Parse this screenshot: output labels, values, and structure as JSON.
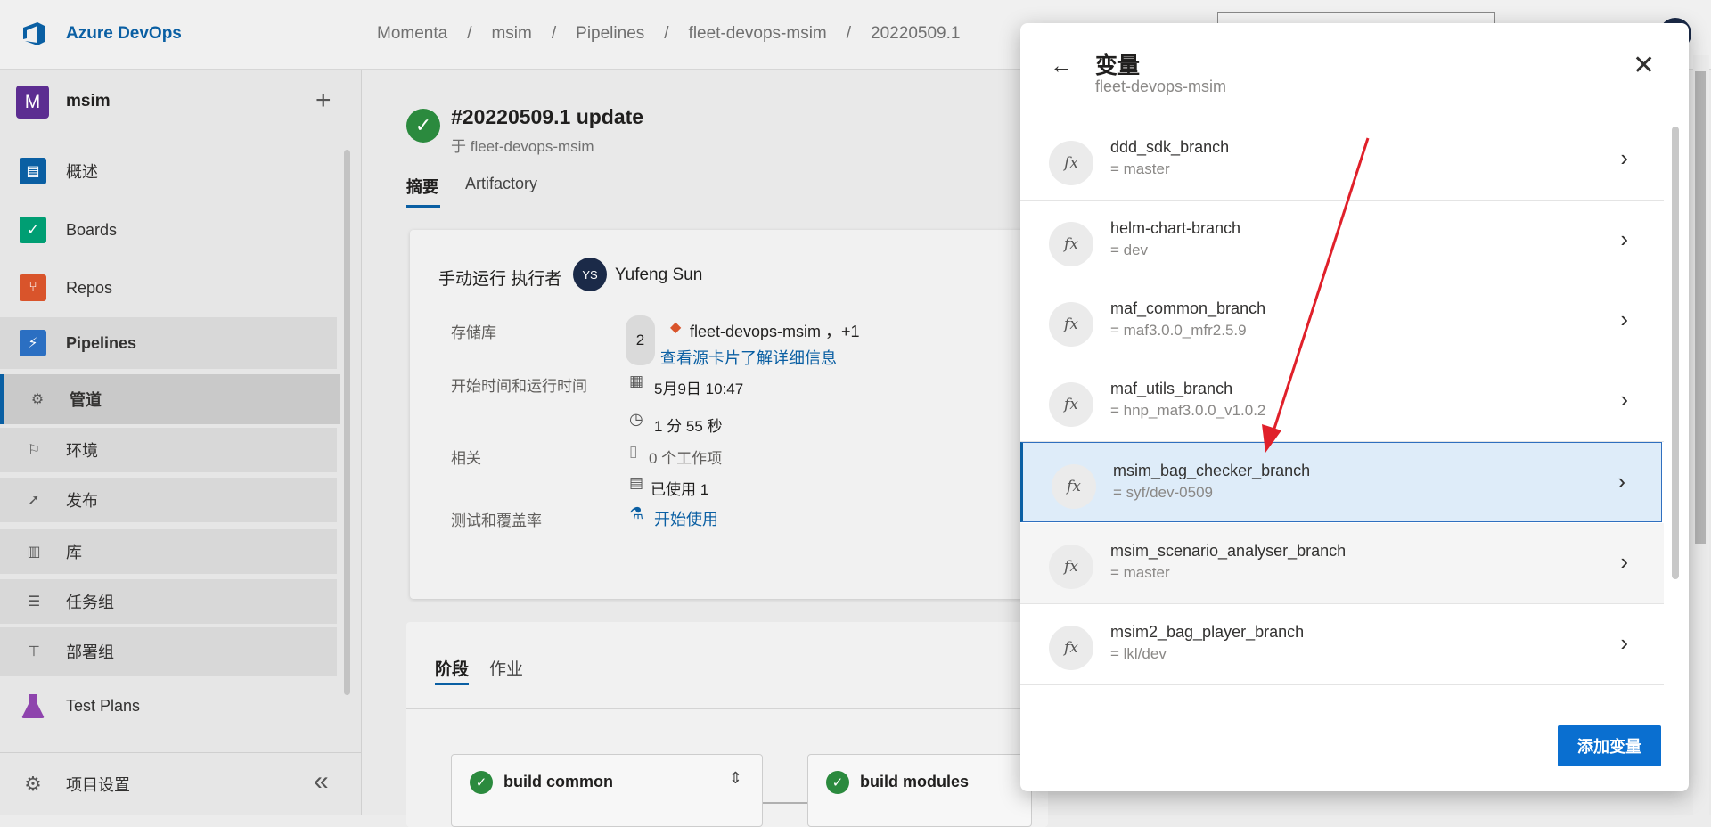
{
  "topbar": {
    "brand": "Azure DevOps",
    "breadcrumbs": [
      "Momenta",
      "msim",
      "Pipelines",
      "fleet-devops-msim",
      "20220509.1"
    ],
    "separator": "/"
  },
  "sidebar": {
    "project_initial": "M",
    "project_name": "msim",
    "add_symbol": "+",
    "items": [
      {
        "label": "概述",
        "icon": "overview-icon",
        "color": "#0a5fa3"
      },
      {
        "label": "Boards",
        "icon": "boards-icon",
        "color": "#009e73"
      },
      {
        "label": "Repos",
        "icon": "repos-icon",
        "color": "#d9542b"
      },
      {
        "label": "Pipelines",
        "icon": "pipelines-icon",
        "color": "#2b6fc2"
      }
    ],
    "sub_items": [
      {
        "label": "管道",
        "icon": "pipelines-sub-icon",
        "glyph": "⚙"
      },
      {
        "label": "环境",
        "icon": "environment-icon",
        "glyph": "⚐"
      },
      {
        "label": "发布",
        "icon": "release-icon",
        "glyph": "➚"
      },
      {
        "label": "库",
        "icon": "library-icon",
        "glyph": "▥"
      },
      {
        "label": "任务组",
        "icon": "task-group-icon",
        "glyph": "☰"
      },
      {
        "label": "部署组",
        "icon": "deployment-group-icon",
        "glyph": "⊤"
      }
    ],
    "test_plans": "Test Plans",
    "settings": "项目设置",
    "collapse_symbol": "«"
  },
  "run": {
    "title": "#20220509.1 update",
    "subtitle": "于 fleet-devops-msim",
    "tabs": [
      "摘要",
      "Artifactory"
    ],
    "manual_run": "手动运行 执行者",
    "user_initials": "YS",
    "user_name": "Yufeng Sun",
    "repo_label": "存储库",
    "repo_count": "2",
    "repo_value": "fleet-devops-msim ，+1",
    "repo_link": "查看源卡片了解详细信息",
    "time_label": "开始时间和运行时间",
    "start_time": "5月9日 10:47",
    "duration": "1 分 55 秒",
    "related_label": "相关",
    "work_items": "0 个工作项",
    "used": "已使用 1",
    "test_label": "测试和覆盖率",
    "test_link": "开始使用"
  },
  "stages": {
    "tabs": [
      "阶段",
      "作业"
    ],
    "items": [
      "build common",
      "build modules"
    ]
  },
  "panel": {
    "title": "变量",
    "subtitle": "fleet-devops-msim",
    "fx_label": "fx",
    "variables": [
      {
        "name": "ddd_sdk_branch",
        "value": "= master"
      },
      {
        "name": "helm-chart-branch",
        "value": "= dev"
      },
      {
        "name": "maf_common_branch",
        "value": "= maf3.0.0_mfr2.5.9"
      },
      {
        "name": "maf_utils_branch",
        "value": "= hnp_maf3.0.0_v1.0.2"
      },
      {
        "name": "msim_bag_checker_branch",
        "value": "= syf/dev-0509"
      },
      {
        "name": "msim_scenario_analyser_branch",
        "value": "= master"
      },
      {
        "name": "msim2_bag_player_branch",
        "value": "= lkl/dev"
      }
    ],
    "add_button": "添加变量"
  },
  "colors": {
    "accent": "#0a5fa3",
    "success": "#2b8a3e",
    "selected_row": "#deecf9",
    "annotation_arrow": "#e0202a"
  }
}
